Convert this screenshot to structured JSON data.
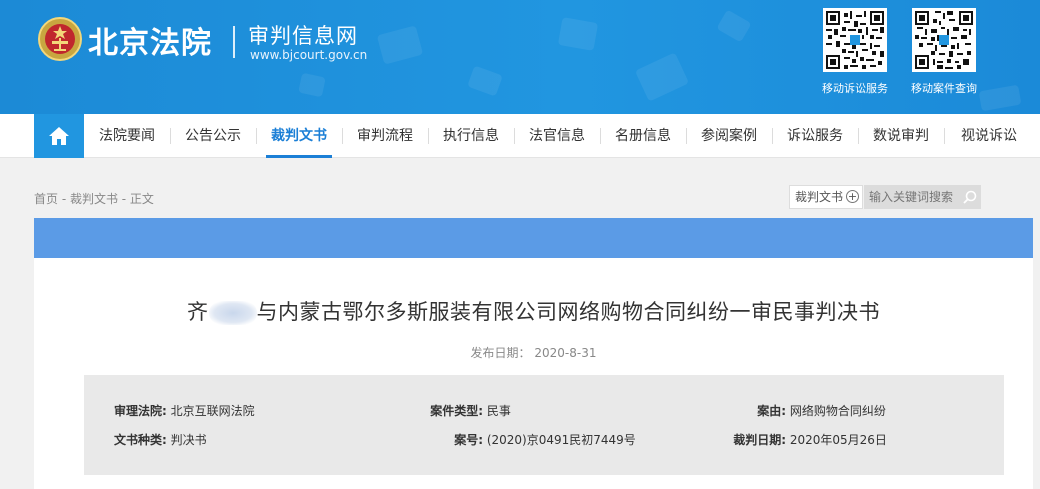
{
  "header": {
    "brand": "北京法院",
    "site_name": "审判信息网",
    "site_url": "www.bjcourt.gov.cn",
    "qr_codes": [
      {
        "label": "移动诉讼服务"
      },
      {
        "label": "移动案件查询"
      }
    ]
  },
  "nav": {
    "home_icon": "home-icon",
    "items": [
      {
        "label": "法院要闻"
      },
      {
        "label": "公告公示"
      },
      {
        "label": "裁判文书",
        "active": true
      },
      {
        "label": "审判流程"
      },
      {
        "label": "执行信息"
      },
      {
        "label": "法官信息"
      },
      {
        "label": "名册信息"
      },
      {
        "label": "参阅案例"
      },
      {
        "label": "诉讼服务"
      },
      {
        "label": "数说审判"
      },
      {
        "label": "视说诉讼"
      }
    ]
  },
  "breadcrumb": "首页 - 裁判文书 - 正文",
  "search": {
    "type_label": "裁判文书",
    "placeholder": "输入关键词搜索"
  },
  "document": {
    "title_prefix": "齐",
    "title_rest": "与内蒙古鄂尔多斯服装有限公司网络购物合同纠纷一审民事判决书",
    "publish_label": "发布日期：",
    "publish_date": "2020-8-31"
  },
  "case_info": {
    "court_label": "审理法院:",
    "court": "北京互联网法院",
    "case_type_label": "案件类型:",
    "case_type": "民事",
    "cause_label": "案由:",
    "cause": "网络购物合同纠纷",
    "doc_type_label": "文书种类:",
    "doc_type": "判决书",
    "case_no_label": "案号:",
    "case_no": "(2020)京0491民初7449号",
    "judgment_date_label": "裁判日期:",
    "judgment_date": "2020年05月26日"
  },
  "colors": {
    "header_blue": "#2196e0",
    "nav_active": "#1b7fd6",
    "content_bar": "#5b9be6"
  }
}
